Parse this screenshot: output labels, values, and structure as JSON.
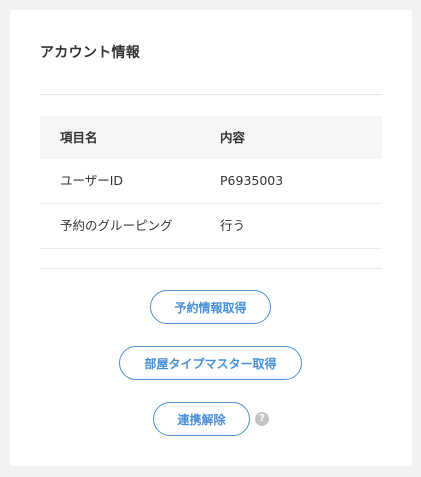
{
  "card": {
    "title": "アカウント情報"
  },
  "table": {
    "headers": [
      "項目名",
      "内容"
    ],
    "rows": [
      [
        "ユーザーID",
        "P6935003"
      ],
      [
        "予約のグルーピング",
        "行う"
      ]
    ]
  },
  "actions": {
    "fetch_reservations_label": "予約情報取得",
    "fetch_room_types_label": "部屋タイプマスター取得",
    "unlink_label": "連携解除",
    "help_glyph": "?"
  },
  "colors": {
    "accent": "#4a90d9",
    "help_icon": "#c4c4c4",
    "header_bg": "#f5f5f5",
    "page_bg": "#f2f2f2"
  },
  "icons": {
    "help": "question-circle-icon"
  }
}
